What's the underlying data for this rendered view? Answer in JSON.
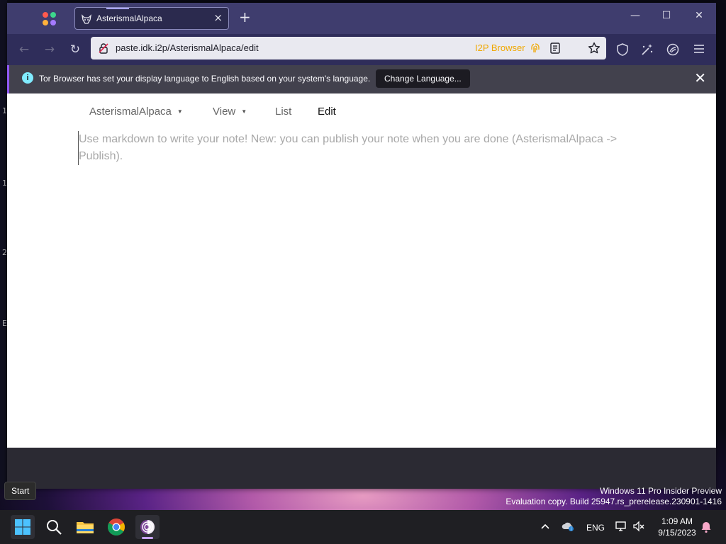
{
  "desktop": {
    "edge_glyphs": [
      "1",
      "2",
      "E"
    ],
    "watermark": {
      "line1": "Windows 11 Pro Insider Preview",
      "line2": "Evaluation copy. Build 25947.rs_prerelease.230901-1416"
    },
    "start_tooltip": "Start"
  },
  "browser": {
    "tab": {
      "title": "AsterismalAlpaca",
      "favicon": "alpaca-favicon",
      "close_icon": "×"
    },
    "new_tab_icon": "+",
    "window_controls": {
      "minimize": "—",
      "maximize": "☐",
      "close": "✕"
    },
    "toolbar": {
      "back_icon": "←",
      "forward_icon": "→",
      "reload_icon": "↻",
      "url": "paste.idk.i2p/AsterismalAlpaca/edit",
      "i2p_label": "I2P Browser",
      "icons": [
        "reader-view-icon",
        "bookmark-star-icon",
        "shield-icon",
        "magic-wand-icon",
        "tor-circuit-icon",
        "hamburger-menu-icon"
      ]
    },
    "notification": {
      "text": "Tor Browser has set your display language to English based on your system's language.",
      "button": "Change Language...",
      "close_icon": "✕"
    }
  },
  "page": {
    "nav": [
      {
        "label": "AsterismalAlpaca",
        "has_dropdown": true
      },
      {
        "label": "View",
        "has_dropdown": true
      },
      {
        "label": "List",
        "has_dropdown": false
      },
      {
        "label": "Edit",
        "has_dropdown": false,
        "active": true
      }
    ],
    "editor": {
      "placeholder": "Use markdown to write your note! New: you can publish your note when you are done (AsterismalAlpaca -> Publish).",
      "value": ""
    }
  },
  "taskbar": {
    "apps": [
      "start-button",
      "search",
      "file-explorer",
      "chrome",
      "tor-browser"
    ],
    "active_app": "tor-browser",
    "tray": {
      "language": "ENG",
      "time": "1:09 AM",
      "date": "9/15/2023"
    }
  },
  "colors": {
    "tab_strip": "#3f3d6e",
    "toolbar": "#2f2d5a",
    "url_bar": "#e9e9f0",
    "i2p_accent": "#f0a800",
    "notification_bg": "#42414d",
    "taskbar": "#1f1f23"
  }
}
